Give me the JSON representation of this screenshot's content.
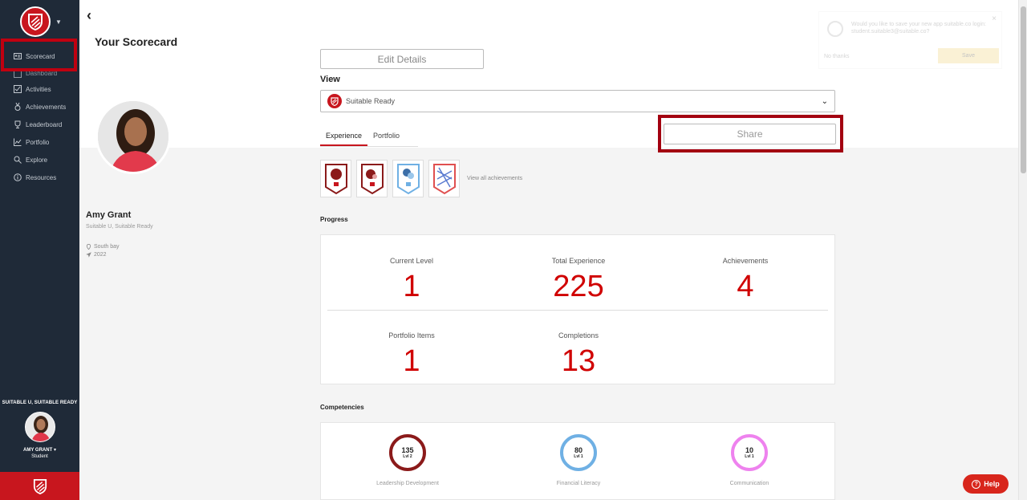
{
  "sidebar": {
    "items": [
      {
        "label": "Scorecard",
        "icon": "id-card-icon"
      },
      {
        "label": "Dashboard",
        "icon": "dashboard-icon"
      },
      {
        "label": "Activities",
        "icon": "checkbox-icon"
      },
      {
        "label": "Achievements",
        "icon": "medal-icon"
      },
      {
        "label": "Leaderboard",
        "icon": "trophy-icon"
      },
      {
        "label": "Portfolio",
        "icon": "chart-icon"
      },
      {
        "label": "Explore",
        "icon": "explore-icon"
      },
      {
        "label": "Resources",
        "icon": "info-icon"
      }
    ],
    "org": "SUITABLE U, SUITABLE READY",
    "user_name": "AMY GRANT",
    "user_role": "Student"
  },
  "page": {
    "title": "Your Scorecard",
    "edit_label": "Edit Details",
    "view_label": "View",
    "view_selected": "Suitable Ready",
    "share_label": "Share",
    "tabs": [
      {
        "label": "Experience"
      },
      {
        "label": "Portfolio"
      }
    ],
    "view_all": "View all achievements",
    "progress_title": "Progress",
    "competencies_title": "Competencies"
  },
  "profile": {
    "name": "Amy Grant",
    "subtitle": "Suitable U, Suitable Ready",
    "location": "South bay",
    "year": "2022"
  },
  "progress": {
    "current_level_label": "Current Level",
    "current_level": "1",
    "total_exp_label": "Total Experience",
    "total_exp": "225",
    "achievements_label": "Achievements",
    "achievements": "4",
    "portfolio_label": "Portfolio Items",
    "portfolio": "1",
    "completions_label": "Completions",
    "completions": "13"
  },
  "competencies": [
    {
      "value": "135",
      "level": "Lvl 2",
      "label": "Leadership Development",
      "color": "#8b1a1a"
    },
    {
      "value": "80",
      "level": "Lvl 1",
      "label": "Financial Literacy",
      "color": "#6fb0e4"
    },
    {
      "value": "10",
      "level": "Lvl 1",
      "label": "Communication",
      "color": "#ee82ee"
    }
  ],
  "toast": {
    "message": "Would you like to save your new app suitable.co login: student.suitable3@suitable.co?",
    "no_label": "No thanks",
    "save_label": "Save"
  },
  "help_label": "Help",
  "colors": {
    "brand": "#c8161e",
    "sidebar": "#1f2a38",
    "stat": "#d00000"
  }
}
